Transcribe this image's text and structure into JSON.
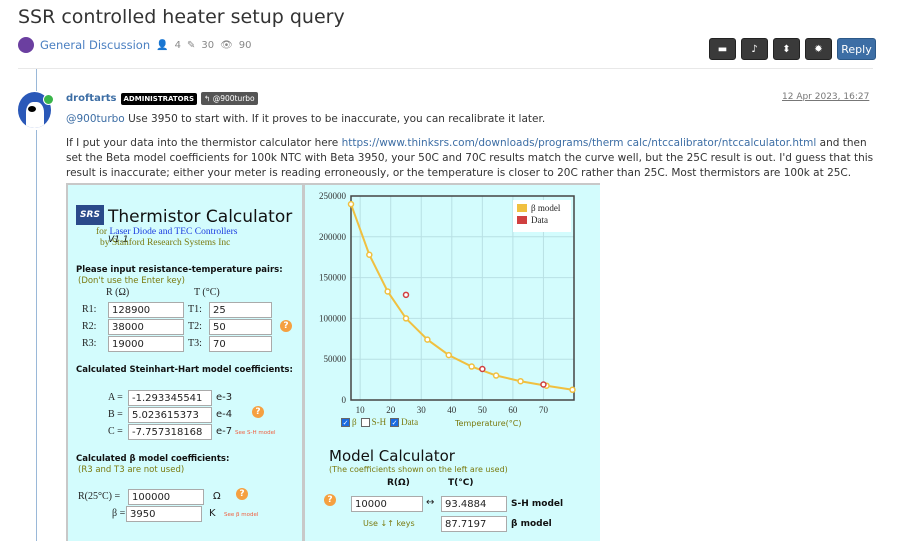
{
  "topic": {
    "title": "SSR controlled heater setup query",
    "category": "General Discussion",
    "posters": "4",
    "posts": "30",
    "views": "90"
  },
  "toolbar": {
    "reply_label": "Reply",
    "icons": [
      "inbox-icon",
      "bell-icon",
      "sort-icon",
      "gear-icon"
    ]
  },
  "post": {
    "username": "droftarts",
    "group_badge": "ADMINISTRATORS",
    "reply_to": "@900turbo",
    "timestamp": "12 Apr 2023, 16:27",
    "mention": "@900turbo",
    "line1": " Use 3950 to start with. If it proves to be inaccurate, you can recalibrate it later.",
    "p2_before": "If I put your data into the thermistor calculator here ",
    "link": "https://www.thinksrs.com/downloads/programs/therm calc/ntccalibrator/ntccalculator.html",
    "p2_after": " and then set the Beta model coefficients for 100k NTC with Beta 3950, your 50C and 70C results match the curve well, but the 25C result is out. I'd guess that this result is inaccurate; either your meter is reading erroneously, or the temperature is closer to 20C rather than 25C. Most thermistors are 100k at 25C."
  },
  "calc": {
    "logo": "SRS",
    "title": "Thermistor Calculator",
    "version": "V1.1",
    "sub1_a": "for ",
    "sub1_b": "Laser Diode and TEC Controllers",
    "sub2": "by Stanford Research Systems Inc",
    "pairs_heading": "Please input resistance-temperature pairs:",
    "pairs_note": "(Don't use the Enter key)",
    "r_header": "R (Ω)",
    "t_header": "T (°C)",
    "rows": [
      {
        "rl": "R1:",
        "r": "128900",
        "tl": "T1:",
        "t": "25"
      },
      {
        "rl": "R2:",
        "r": "38000",
        "tl": "T2:",
        "t": "50"
      },
      {
        "rl": "R3:",
        "r": "19000",
        "tl": "T3:",
        "t": "70"
      }
    ],
    "sh_heading": "Calculated Steinhart-Hart model coefficients:",
    "sh": [
      {
        "l": "A =",
        "v": "-1.293345541",
        "e": "e-3"
      },
      {
        "l": "B =",
        "v": "5.023615373",
        "e": "e-4"
      },
      {
        "l": "C =",
        "v": "-7.757318168",
        "e": "e-7"
      }
    ],
    "sh_link": "See S-H model",
    "beta_heading": "Calculated β model coefficients:",
    "beta_note": "(R3 and T3 are not used)",
    "r25_label": "R(25°C) =",
    "r25": "100000",
    "r25_unit": "Ω",
    "beta_label": "β =",
    "beta": "3950",
    "beta_unit": "K",
    "beta_link": "See β model",
    "checks": [
      {
        "label": "β",
        "checked": true
      },
      {
        "label": "S-H",
        "checked": false
      },
      {
        "label": "Data",
        "checked": true
      }
    ],
    "model_title": "Model Calculator",
    "model_note": "(The coefficients shown on the left are used)",
    "mr_header": "R(Ω)",
    "mt_header": "T(°C)",
    "mr": "10000",
    "arrow": "↔",
    "sh_t": "93.4884",
    "sh_label": "S-H model",
    "keys": "Use ↓↑ keys",
    "beta_t": "87.7197",
    "beta_model_label": "β model"
  },
  "chart_data": {
    "type": "line",
    "xlabel": "Temperature(°C)",
    "xlim": [
      7,
      80
    ],
    "ylim": [
      0,
      250000
    ],
    "xticks": [
      10,
      20,
      30,
      40,
      50,
      60,
      70
    ],
    "yticks": [
      0,
      50000,
      100000,
      150000,
      200000,
      250000
    ],
    "grid": true,
    "legend": "top-right",
    "series": [
      {
        "name": "β model",
        "color": "#f0c040",
        "x": [
          7,
          13,
          19,
          25,
          32,
          39,
          46.5,
          54.5,
          62.5,
          71,
          79.5
        ],
        "y": [
          240000,
          178000,
          133000,
          100000,
          74000,
          55000,
          41000,
          30000,
          23000,
          17500,
          12500
        ]
      },
      {
        "name": "Data",
        "color": "#d04040",
        "x": [
          25,
          50,
          70
        ],
        "y": [
          128900,
          38000,
          19000
        ]
      }
    ]
  }
}
